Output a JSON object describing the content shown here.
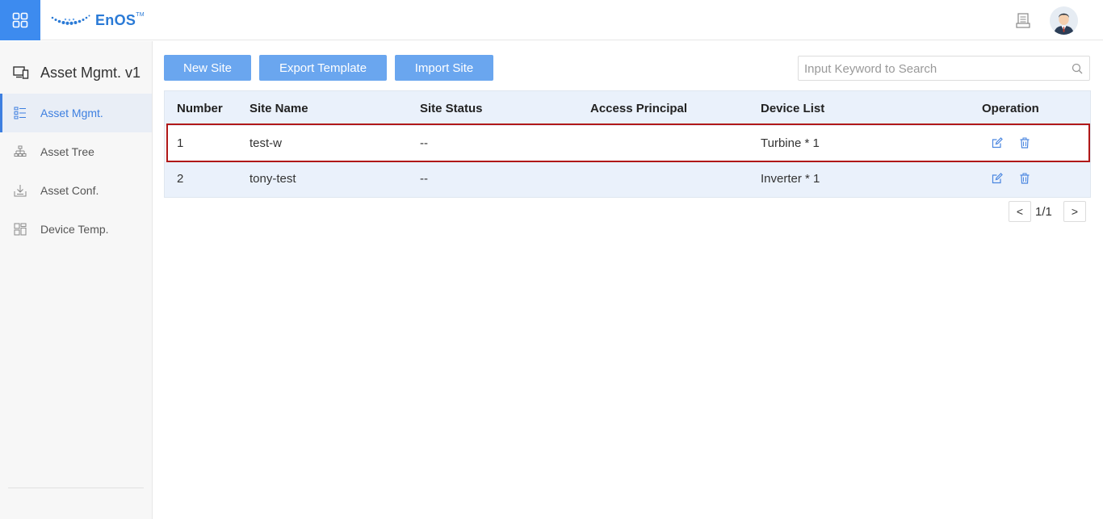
{
  "header": {
    "app_switcher_icon": "grid-icon",
    "logo_text": "EnOS",
    "logo_mark": "TM",
    "doc_icon": "document-icon",
    "avatar_icon": "user-avatar"
  },
  "sidebar": {
    "title": "Asset Mgmt. v1",
    "title_icon": "devices-icon",
    "items": [
      {
        "label": "Asset Mgmt.",
        "icon": "asset-list-icon",
        "active": true
      },
      {
        "label": "Asset Tree",
        "icon": "tree-icon",
        "active": false
      },
      {
        "label": "Asset Conf.",
        "icon": "download-box-icon",
        "active": false
      },
      {
        "label": "Device Temp.",
        "icon": "template-icon",
        "active": false
      }
    ]
  },
  "toolbar": {
    "new_site_label": "New Site",
    "export_template_label": "Export Template",
    "import_site_label": "Import Site",
    "search_placeholder": "Input Keyword to Search",
    "search_value": ""
  },
  "table": {
    "columns": [
      "Number",
      "Site Name",
      "Site Status",
      "Access Principal",
      "Device List",
      "Operation"
    ],
    "rows": [
      {
        "number": "1",
        "site_name": "test-w",
        "site_status": "--",
        "access_principal": "",
        "device_list": "Turbine * 1"
      },
      {
        "number": "2",
        "site_name": "tony-test",
        "site_status": "--",
        "access_principal": "",
        "device_list": "Inverter * 1"
      }
    ]
  },
  "pagination": {
    "prev_label": "<",
    "page_label": "1/1",
    "next_label": ">"
  },
  "colors": {
    "brand": "#3d8bef",
    "button": "#6aa6ef",
    "highlight_border": "#b01818",
    "header_row": "#eaf1fb"
  }
}
